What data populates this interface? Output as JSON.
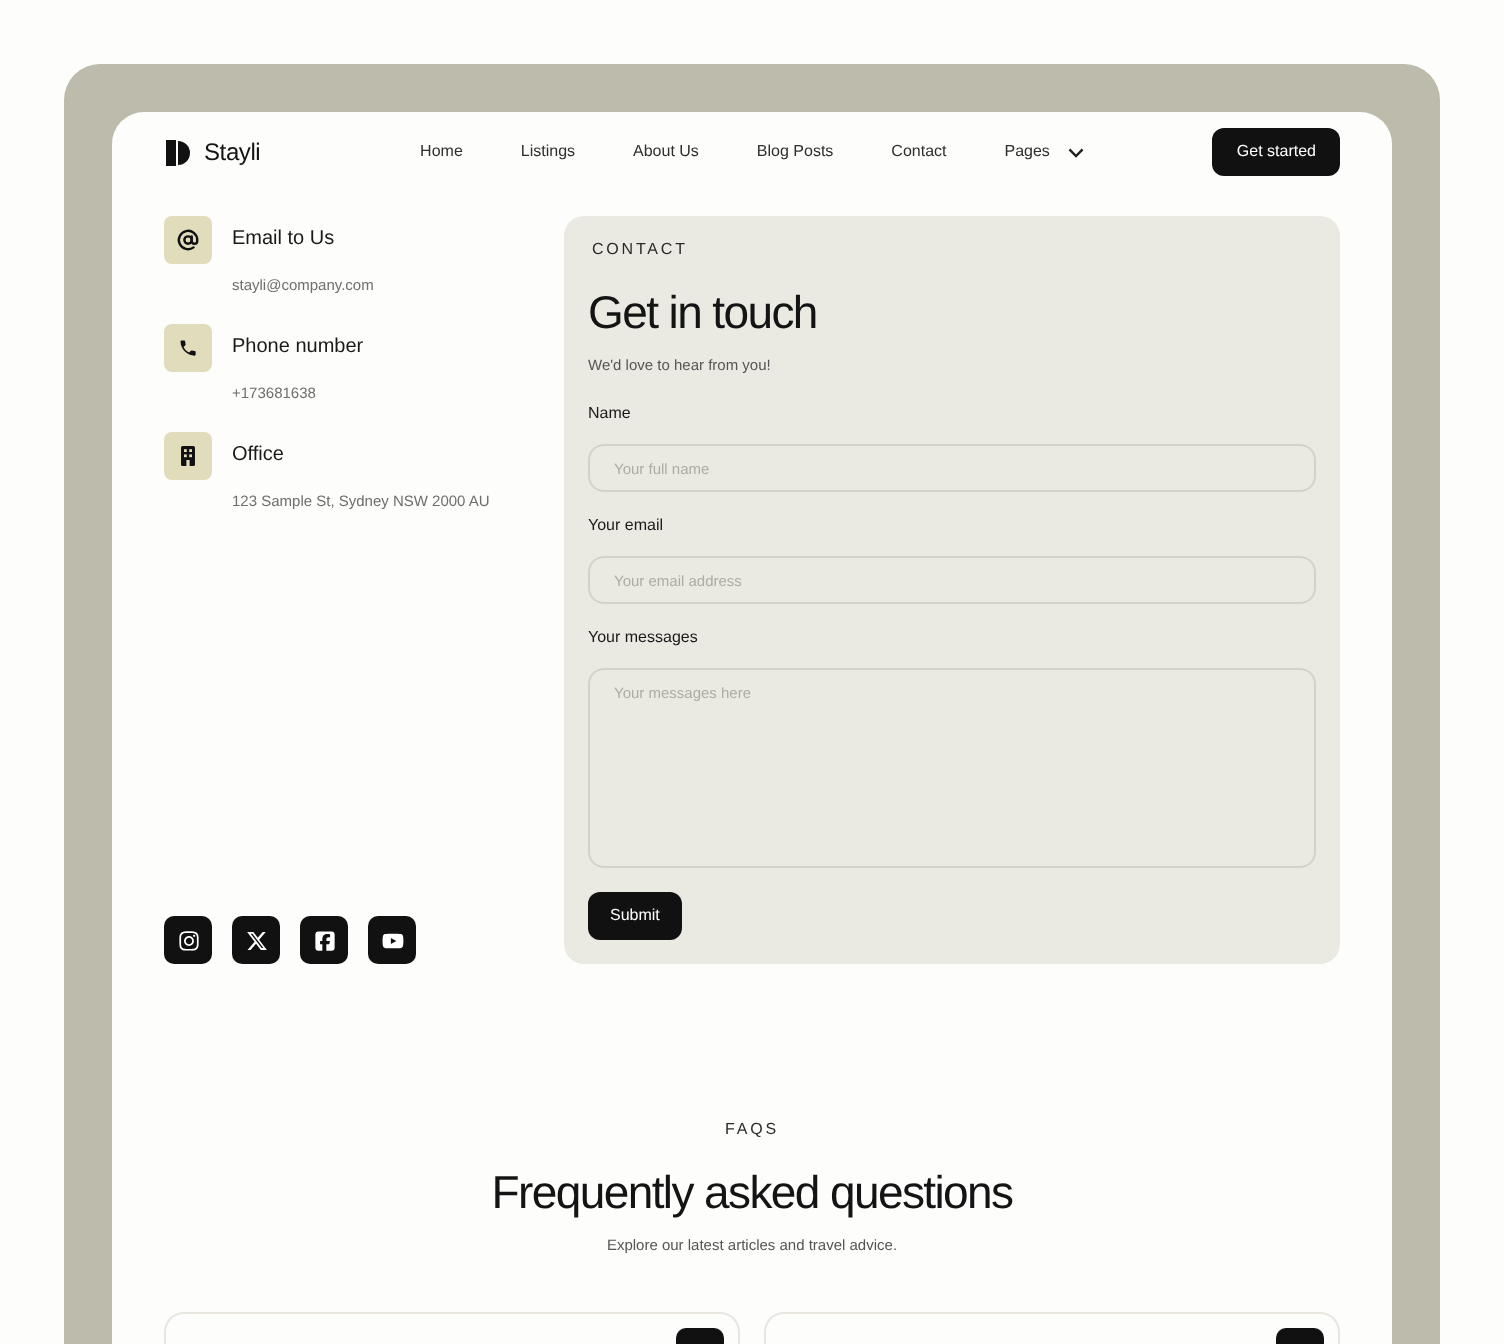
{
  "brand": {
    "name": "Stayli"
  },
  "nav": {
    "items": [
      {
        "label": "Home",
        "has_menu": false
      },
      {
        "label": "Listings",
        "has_menu": false
      },
      {
        "label": "About Us",
        "has_menu": false
      },
      {
        "label": "Blog Posts",
        "has_menu": false
      },
      {
        "label": "Contact",
        "has_menu": false
      },
      {
        "label": "Pages",
        "has_menu": true
      }
    ]
  },
  "header_button": {
    "label": "Get started"
  },
  "contact_info": [
    {
      "kind": "email",
      "title": "Email to Us",
      "detail": "stayli@company.com"
    },
    {
      "kind": "phone",
      "title": "Phone number",
      "detail": "+173681638"
    },
    {
      "kind": "office",
      "title": "Office",
      "detail": "123 Sample St, Sydney NSW 2000 AU"
    }
  ],
  "social_links": [
    {
      "kind": "instagram"
    },
    {
      "kind": "x"
    },
    {
      "kind": "facebook"
    },
    {
      "kind": "youtube"
    }
  ],
  "contact_form": {
    "eyebrow": "CONTACT",
    "title": "Get in touch",
    "subtitle": "We'd love to hear from you!",
    "fields": [
      {
        "kind": "text",
        "label": "Name",
        "placeholder": "Your full name"
      },
      {
        "kind": "email",
        "label": "Your email",
        "placeholder": "Your email address"
      },
      {
        "kind": "textarea",
        "label": "Your messages",
        "placeholder": "Your messages here"
      }
    ],
    "submit": "Submit"
  },
  "faq": {
    "eyebrow": "FAQS",
    "title": "Frequently asked questions",
    "subtitle": "Explore our latest articles and travel advice."
  }
}
